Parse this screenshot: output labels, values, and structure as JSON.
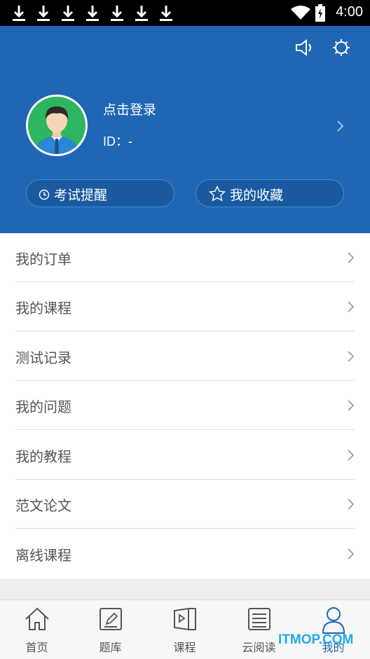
{
  "status_bar": {
    "time": "4:00"
  },
  "profile": {
    "login_text": "点击登录",
    "id_text": "ID：-",
    "buttons": [
      {
        "label": "考试提醒",
        "icon": "clock-icon"
      },
      {
        "label": "我的收藏",
        "icon": "star-icon"
      }
    ]
  },
  "menu": {
    "items": [
      {
        "label": "我的订单"
      },
      {
        "label": "我的课程"
      },
      {
        "label": "测试记录"
      },
      {
        "label": "我的问题"
      },
      {
        "label": "我的教程"
      },
      {
        "label": "范文论文"
      },
      {
        "label": "离线课程"
      }
    ]
  },
  "tabs": [
    {
      "label": "首页",
      "icon": "home-icon"
    },
    {
      "label": "题库",
      "icon": "question-bank-icon"
    },
    {
      "label": "课程",
      "icon": "course-icon"
    },
    {
      "label": "云阅读",
      "icon": "cloud-reading-icon"
    },
    {
      "label": "我的",
      "icon": "profile-icon",
      "active": true
    }
  ],
  "watermark": "ITMOP.COM",
  "colors": {
    "primary": "#1f67b4",
    "avatar_bg": "#2eb55f",
    "watermark": "#21a9ec"
  }
}
